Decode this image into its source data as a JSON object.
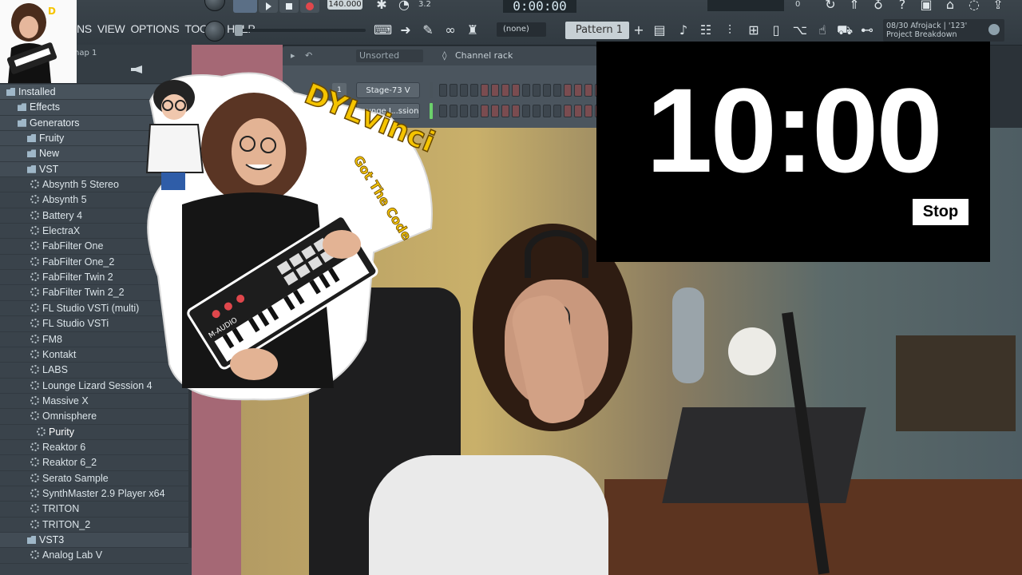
{
  "toolbar": {
    "menu": [
      "NS",
      "VIEW",
      "OPTIONS",
      "TOOLS",
      "HELP"
    ],
    "tempo": "140.000",
    "song_time": "0:00:00",
    "snap": "(none)",
    "pattern": "Pattern 1",
    "cpu_value": "3.2",
    "memory_value": "0",
    "news": {
      "line1": "08/30  Afrojack | '123'",
      "line2": "Project Breakdown"
    }
  },
  "browser": {
    "header_label": "nap 1",
    "items": [
      {
        "label": "Installed",
        "kind": "folder",
        "level": 0
      },
      {
        "label": "Effects",
        "kind": "folder",
        "level": 1
      },
      {
        "label": "Generators",
        "kind": "folder",
        "level": 1
      },
      {
        "label": "Fruity",
        "kind": "folder",
        "level": 2
      },
      {
        "label": "New",
        "kind": "folder",
        "level": 2
      },
      {
        "label": "VST",
        "kind": "folder",
        "level": 2
      },
      {
        "label": "Absynth 5 Stereo",
        "kind": "plugin",
        "level": 3
      },
      {
        "label": "Absynth 5",
        "kind": "plugin",
        "level": 3
      },
      {
        "label": "Battery 4",
        "kind": "plugin",
        "level": 3
      },
      {
        "label": "ElectraX",
        "kind": "plugin",
        "level": 3
      },
      {
        "label": "FabFilter One",
        "kind": "plugin",
        "level": 3
      },
      {
        "label": "FabFilter One_2",
        "kind": "plugin",
        "level": 3
      },
      {
        "label": "FabFilter Twin 2",
        "kind": "plugin",
        "level": 3
      },
      {
        "label": "FabFilter Twin 2_2",
        "kind": "plugin",
        "level": 3
      },
      {
        "label": "FL Studio VSTi (multi)",
        "kind": "plugin",
        "level": 3
      },
      {
        "label": "FL Studio VSTi",
        "kind": "plugin",
        "level": 3
      },
      {
        "label": "FM8",
        "kind": "plugin",
        "level": 3
      },
      {
        "label": "Kontakt",
        "kind": "plugin",
        "level": 3
      },
      {
        "label": "LABS",
        "kind": "plugin",
        "level": 3
      },
      {
        "label": "Lounge Lizard Session 4",
        "kind": "plugin",
        "level": 3
      },
      {
        "label": "Massive X",
        "kind": "plugin",
        "level": 3
      },
      {
        "label": "Omnisphere",
        "kind": "plugin",
        "level": 3
      },
      {
        "label": "Purity",
        "kind": "plugin",
        "level": 4
      },
      {
        "label": "Reaktor 6",
        "kind": "plugin",
        "level": 3
      },
      {
        "label": "Reaktor 6_2",
        "kind": "plugin",
        "level": 3
      },
      {
        "label": "Serato Sample",
        "kind": "plugin",
        "level": 3
      },
      {
        "label": "SynthMaster 2.9 Player x64",
        "kind": "plugin",
        "level": 3
      },
      {
        "label": "TRITON",
        "kind": "plugin",
        "level": 3
      },
      {
        "label": "TRITON_2",
        "kind": "plugin",
        "level": 3
      },
      {
        "label": "VST3",
        "kind": "folder",
        "level": 2
      },
      {
        "label": "Analog Lab V",
        "kind": "plugin",
        "level": 3
      }
    ]
  },
  "channel_rack": {
    "filter": "Unsorted",
    "title": "Channel rack",
    "channels": [
      {
        "number": "1",
        "name": "Stage-73 V"
      },
      {
        "number": "",
        "name": "Lounge L..ssion 4"
      }
    ]
  },
  "timer": {
    "time": "10:00",
    "stop_label": "Stop"
  },
  "sticker": {
    "title": "DYLvinci",
    "tagline": "Got The Code",
    "keyboard_brand": "M-AUDIO"
  },
  "colors": {
    "timer_bg": "#000000",
    "timer_text": "#ffffff",
    "browser_bg": "#3a434b",
    "toolbar_bg": "#353e45",
    "accent_green": "#6bd06b",
    "sticker_yellow": "#f5c400"
  }
}
